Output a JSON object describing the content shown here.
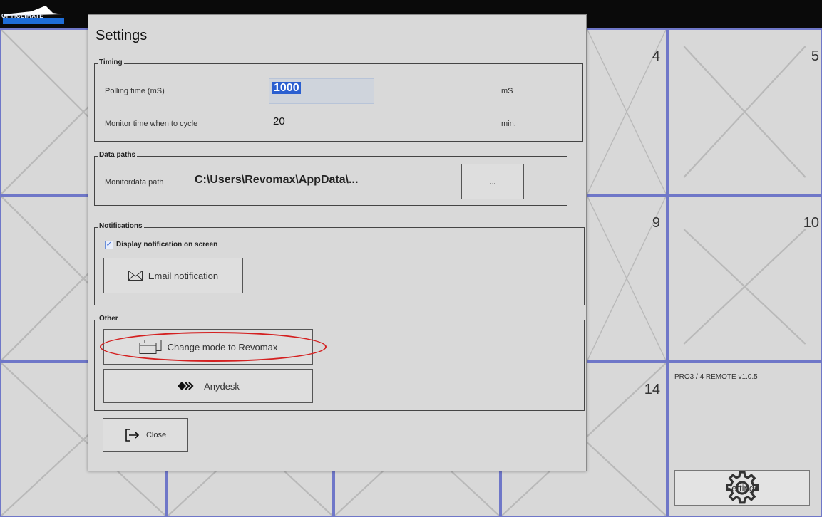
{
  "app": {
    "logo_text": "OPTICLIMATE"
  },
  "tiles": {
    "numbers": [
      "4",
      "5",
      "9",
      "10",
      "14"
    ],
    "remote_title": "PRO3 / 4 REMOTE v1.0.5",
    "settings_label": "Settings"
  },
  "dialog": {
    "title": "Settings",
    "timing": {
      "label": "Timing",
      "polling_label": "Polling time (mS)",
      "polling_value": "1000",
      "polling_unit": "mS",
      "monitor_label": "Monitor time when to cycle",
      "monitor_value": "20",
      "monitor_unit": "min."
    },
    "data_paths": {
      "label": "Data paths",
      "path_label": "Monitordata path",
      "path_value": "C:\\Users\\Revomax\\AppData\\...",
      "browse_label": "..."
    },
    "notifications": {
      "label": "Notifications",
      "display_checkbox_label": "Display notification on screen",
      "display_checked": true,
      "email_label": "Email notification"
    },
    "other": {
      "label": "Other",
      "change_mode_label": "Change mode to Revomax",
      "anydesk_label": "Anydesk"
    },
    "close_label": "Close"
  },
  "colors": {
    "tile_border": "#6f77c8",
    "highlight_ellipse": "#d42020",
    "selection": "#2b5fd0"
  }
}
